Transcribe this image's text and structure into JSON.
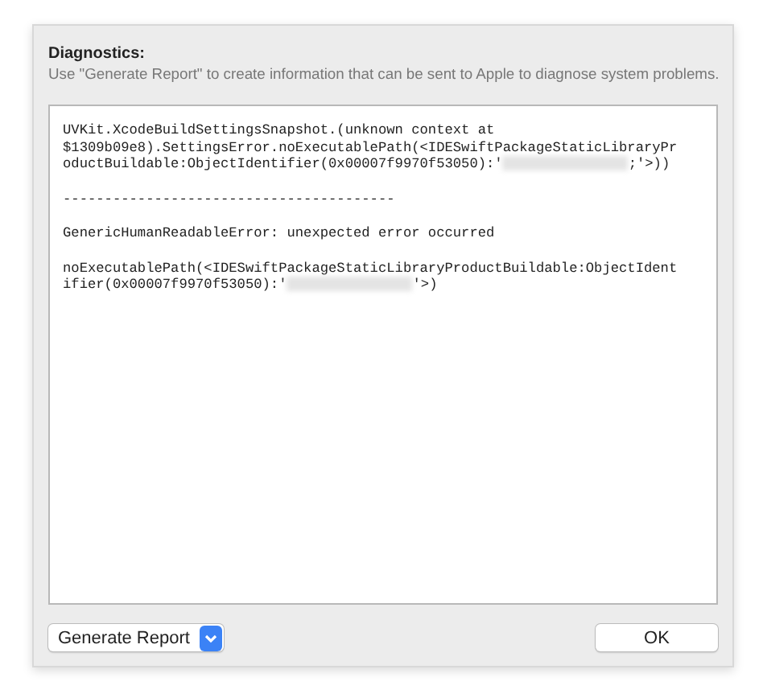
{
  "header": {
    "title": "Diagnostics:",
    "description": "Use \"Generate Report\" to create information that can be sent to Apple to diagnose system problems."
  },
  "log": [
    [
      [
        {
          "kind": "text",
          "text": "UVKit.XcodeBuildSettingsSnapshot.(unknown context at"
        }
      ],
      [
        {
          "kind": "text",
          "text": "$1309b09e8).SettingsError.noExecutablePath(<IDESwiftPackageStaticLibraryPr"
        }
      ],
      [
        {
          "kind": "text",
          "text": "oductBuildable:ObjectIdentifier(0x00007f9970f53050):'"
        },
        {
          "kind": "redacted"
        },
        {
          "kind": "text",
          "text": ";'>))"
        }
      ]
    ],
    [
      [
        {
          "kind": "text",
          "text": "----------------------------------------"
        }
      ]
    ],
    [
      [
        {
          "kind": "text",
          "text": "GenericHumanReadableError: unexpected error occurred"
        }
      ]
    ],
    [
      [
        {
          "kind": "text",
          "text": "noExecutablePath(<IDESwiftPackageStaticLibraryProductBuildable:ObjectIdent"
        }
      ],
      [
        {
          "kind": "text",
          "text": "ifier(0x00007f9970f53050):'"
        },
        {
          "kind": "redacted"
        },
        {
          "kind": "text",
          "text": "'>)"
        }
      ]
    ]
  ],
  "buttons": {
    "generate": "Generate Report",
    "ok": "OK"
  }
}
